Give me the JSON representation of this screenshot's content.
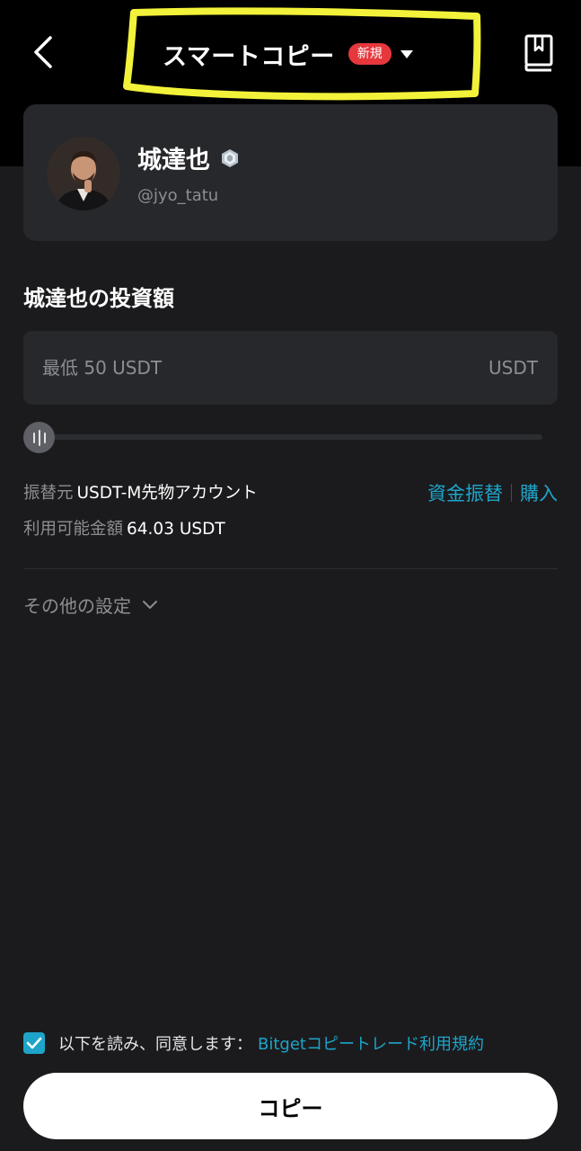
{
  "header": {
    "title": "スマートコピー",
    "badge": "新規",
    "highlight_color": "#f2f23a"
  },
  "trader": {
    "name": "城達也",
    "handle": "@jyo_tatu"
  },
  "investment": {
    "section_title": "城達也の投資額",
    "amount_placeholder": "最低 50 USDT",
    "amount_value": "",
    "unit": "USDT",
    "slider_fraction": 0
  },
  "account": {
    "source_label": "振替元",
    "source_value": "USDT-M先物アカウント",
    "available_label": "利用可能金額",
    "available_value": "64.03 USDT",
    "transfer_link": "資金振替",
    "buy_link": "購入"
  },
  "other_settings": {
    "label": "その他の設定"
  },
  "agreement": {
    "checked": true,
    "text": "以下を読み、同意します：",
    "link": "Bitgetコピートレード利用規約"
  },
  "actions": {
    "copy_label": "コピー"
  },
  "colors": {
    "accent": "#1fa4c9",
    "badge": "#e6373c",
    "background": "#1b1b1d",
    "card": "#27282c"
  }
}
